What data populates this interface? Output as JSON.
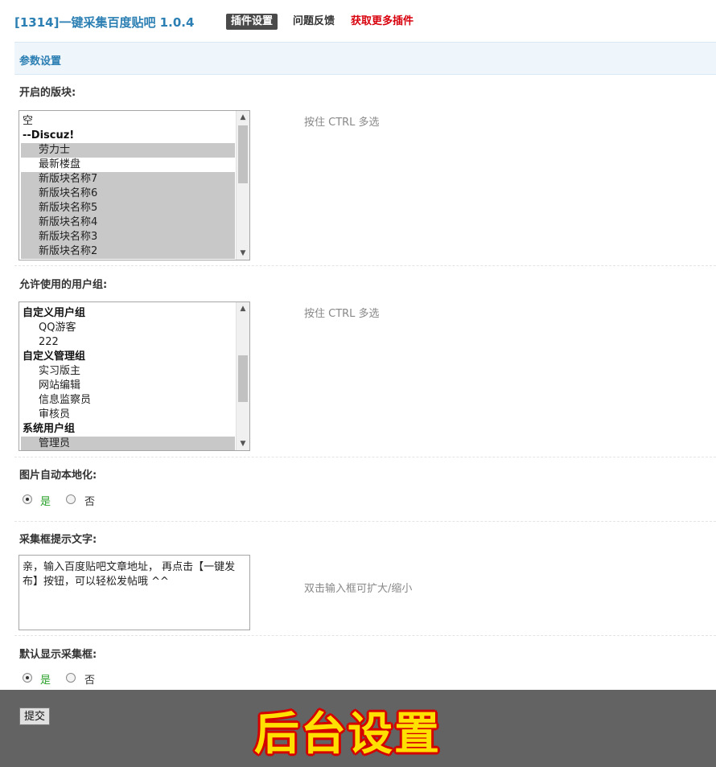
{
  "header": {
    "title": "[1314]一键采集百度贴吧 1.0.4",
    "tabs": [
      {
        "label": "插件设置"
      },
      {
        "label": "问题反馈"
      },
      {
        "label": "获取更多插件"
      }
    ]
  },
  "section": {
    "title": "参数设置"
  },
  "forums": {
    "label": "开启的版块:",
    "hint": "按住 CTRL 多选",
    "items": [
      {
        "label": "空",
        "kind": "item"
      },
      {
        "label": "--Discuz!",
        "kind": "group"
      },
      {
        "label": "劳力士",
        "kind": "indent-selected"
      },
      {
        "label": "最新楼盘",
        "kind": "indent"
      },
      {
        "label": "新版块名称7",
        "kind": "indent-selected"
      },
      {
        "label": "新版块名称6",
        "kind": "indent-selected"
      },
      {
        "label": "新版块名称5",
        "kind": "indent-selected"
      },
      {
        "label": "新版块名称4",
        "kind": "indent-selected"
      },
      {
        "label": "新版块名称3",
        "kind": "indent-selected"
      },
      {
        "label": "新版块名称2",
        "kind": "indent-selected"
      }
    ]
  },
  "usergroups": {
    "label": "允许使用的用户组:",
    "hint": "按住 CTRL 多选",
    "items": [
      {
        "label": "自定义用户组",
        "kind": "group"
      },
      {
        "label": "QQ游客",
        "kind": "indent"
      },
      {
        "label": "222",
        "kind": "indent"
      },
      {
        "label": "自定义管理组",
        "kind": "group"
      },
      {
        "label": "实习版主",
        "kind": "indent"
      },
      {
        "label": "网站编辑",
        "kind": "indent"
      },
      {
        "label": "信息监察员",
        "kind": "indent"
      },
      {
        "label": "审核员",
        "kind": "indent"
      },
      {
        "label": "系统用户组",
        "kind": "group"
      },
      {
        "label": "管理员",
        "kind": "indent-selected"
      }
    ]
  },
  "localize_images": {
    "label": "图片自动本地化:",
    "yes": "是",
    "no": "否",
    "selected": "yes"
  },
  "prompt_text": {
    "label": "采集框提示文字:",
    "value": "亲，输入百度贴吧文章地址， 再点击【一键发布】按钮，可以轻松发帖哦 ^^",
    "hint": "双击输入框可扩大/缩小"
  },
  "show_collector": {
    "label": "默认显示采集框:",
    "yes": "是",
    "no": "否",
    "selected": "yes"
  },
  "footer": {
    "submit_label": "提交",
    "banner": "后台设置"
  },
  "colors": {
    "title": "#2b7fb3",
    "accent_red": "#d8000c",
    "radio_yes": "#2aa12a",
    "banner_fill": "#ffe000",
    "banner_stroke": "#d40000"
  }
}
